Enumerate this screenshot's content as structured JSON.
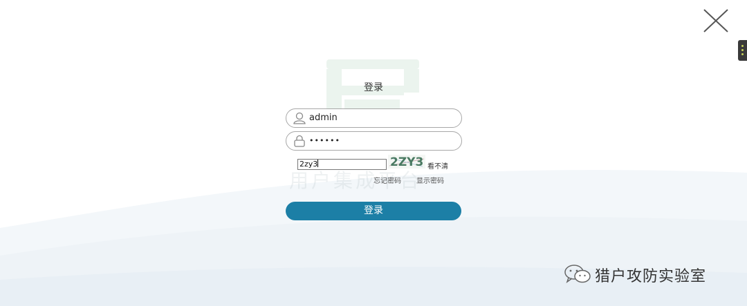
{
  "login": {
    "title": "登录",
    "username": "admin",
    "password_mask": "••••••",
    "captcha_value": "2zy3",
    "captcha_image_text": "2ZY3",
    "captcha_refresh_label": "看不清",
    "forgot_password_label": "忘记密码",
    "show_password_label": "显示密码",
    "submit_label": "登录"
  },
  "watermark": {
    "text": "用户集成平台"
  },
  "brand": {
    "name": "猎户攻防实验室"
  },
  "colors": {
    "button": "#1c7fa6",
    "field_border": "#a7a7a7",
    "watermark_logo": "#2f8a4a"
  },
  "icons": {
    "close": "close-icon",
    "user": "user-icon",
    "lock": "lock-icon",
    "wechat": "wechat-icon"
  }
}
